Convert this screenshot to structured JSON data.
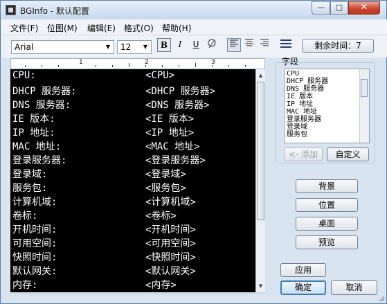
{
  "window": {
    "title": "BGInfo - 默认配置",
    "minimize_glyph": "—",
    "maximize_glyph": "□",
    "close_glyph": "✕"
  },
  "menu": [
    "文件(F)",
    "位图(M)",
    "编辑(E)",
    "格式(O)",
    "帮助(H)"
  ],
  "toolbar": {
    "font": "Arial",
    "size": "12",
    "bold_label": "B",
    "italic_label": "I",
    "underline_label": "U",
    "time_button": "剩余时间：7"
  },
  "ruler": {
    "numbers": [
      "1",
      "2",
      "3"
    ]
  },
  "editor": {
    "rows": [
      {
        "label": "CPU:",
        "value": "<CPU>"
      },
      {
        "label": "DHCP 服务器:",
        "value": "<DHCP 服务器>"
      },
      {
        "label": "DNS 服务器:",
        "value": "<DNS 服务器>"
      },
      {
        "label": "IE 版本:",
        "value": "<IE 版本>"
      },
      {
        "label": "IP 地址:",
        "value": "<IP 地址>"
      },
      {
        "label": "MAC 地址:",
        "value": "<MAC 地址>"
      },
      {
        "label": "登录服务器:",
        "value": "<登录服务器>"
      },
      {
        "label": "登录域:",
        "value": "<登录域>"
      },
      {
        "label": "服务包:",
        "value": "<服务包>"
      },
      {
        "label": "计算机域:",
        "value": "<计算机域>"
      },
      {
        "label": "卷标:",
        "value": "<卷标>"
      },
      {
        "label": "开机时间:",
        "value": "<开机时间>"
      },
      {
        "label": "可用空间:",
        "value": "<可用空间>"
      },
      {
        "label": "快照时间:",
        "value": "<快照时间>"
      },
      {
        "label": "默认网关:",
        "value": "<默认网关>"
      },
      {
        "label": "内存:",
        "value": "<内存>"
      }
    ]
  },
  "fields": {
    "label": "字段",
    "items": [
      "CPU",
      "DHCP 服务器",
      "DNS 服务器",
      "IE 版本",
      "IP 地址",
      "MAC 地址",
      "登录服务器",
      "登录域",
      "服务包"
    ],
    "add_button": "<- 添加",
    "custom_button": "自定义"
  },
  "side_buttons": {
    "background": "背景",
    "position": "位置",
    "desktop": "桌面",
    "preview": "预览"
  },
  "footer": {
    "apply": "应用",
    "ok": "确定",
    "cancel": "取消"
  }
}
